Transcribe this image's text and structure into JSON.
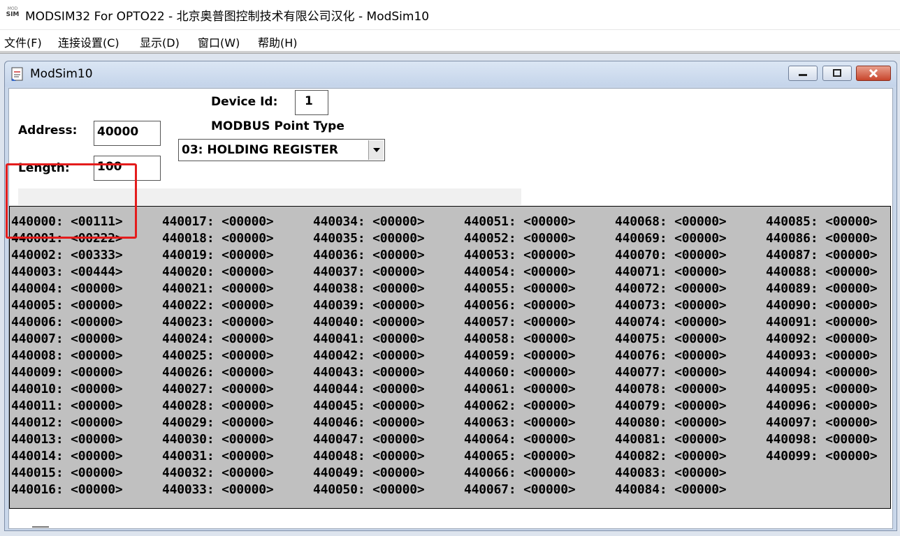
{
  "app": {
    "title": "MODSIM32 For OPTO22 - 北京奥普图控制技术有限公司汉化 - ModSim10",
    "icon_text": "ModSim32"
  },
  "menu": [
    "文件(F)",
    "连接设置(C)",
    "显示(D)",
    "窗口(W)",
    "帮助(H)"
  ],
  "child_window": {
    "title": "ModSim10",
    "icons": {
      "minimize": "minimize-icon",
      "maximize": "maximize-icon",
      "close": "close-icon"
    }
  },
  "form": {
    "device_id_label": "Device Id:",
    "device_id_value": "1",
    "point_type_label": "MODBUS Point Type",
    "point_type_value": "03: HOLDING REGISTER",
    "address_label": "Address:",
    "address_value": "40000",
    "length_label": "Length:",
    "length_value": "100"
  },
  "registers": {
    "prefix": "4",
    "start": 40000,
    "count": 100,
    "rows_per_column": 17,
    "values": {
      "40000": "00111",
      "40001": "00222",
      "40002": "00333",
      "40003": "00444"
    },
    "default_value": "00000"
  },
  "colors": {
    "highlight": "#e41c1c",
    "data_bg": "#c0c0c0",
    "title_bar": "#c9d7ea"
  }
}
